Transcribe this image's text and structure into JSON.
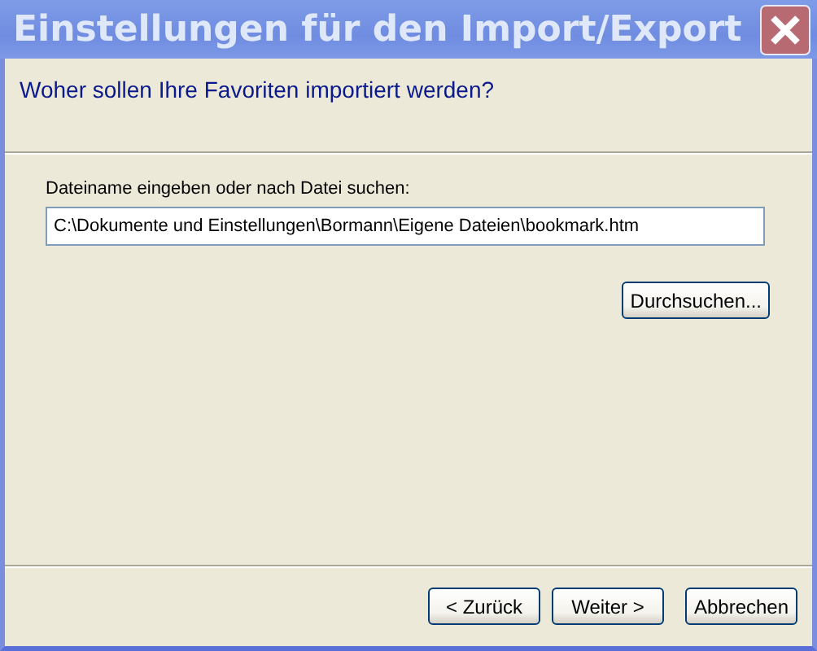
{
  "window": {
    "title": "Einstellungen für den Import/Export"
  },
  "header": {
    "question": "Woher sollen Ihre Favoriten importiert werden?"
  },
  "file": {
    "label": "Dateiname eingeben oder nach Datei suchen:",
    "value": "C:\\Dokumente und Einstellungen\\Bormann\\Eigene Dateien\\bookmark.htm",
    "browse_button": "Durchsuchen..."
  },
  "buttons": [
    {
      "label": "< Zurück"
    },
    {
      "label": "Weiter >"
    },
    {
      "label": "Abbrechen"
    }
  ]
}
